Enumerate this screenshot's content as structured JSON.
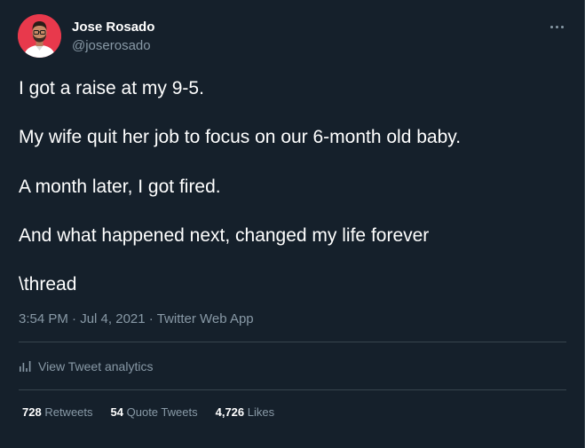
{
  "user": {
    "display_name": "Jose Rosado",
    "handle": "@joserosado"
  },
  "tweet": {
    "lines": [
      "I got a raise at my 9-5.",
      "My wife quit her job to focus on our 6-month old baby.",
      "A month later, I got fired.",
      "And what happened next, changed my life forever",
      "\\thread"
    ],
    "time": "3:54 PM",
    "separator": "·",
    "date": "Jul 4, 2021",
    "source": "Twitter Web App"
  },
  "analytics": {
    "label": "View Tweet analytics",
    "icon": "bar-chart-icon"
  },
  "stats": {
    "retweets_count": "728",
    "retweets_label": "Retweets",
    "quote_count": "54",
    "quote_label": "Quote Tweets",
    "likes_count": "4,726",
    "likes_label": "Likes"
  },
  "icons": {
    "more": "more-options-icon",
    "avatar": "avatar"
  },
  "colors": {
    "background": "#15202b",
    "primary_text": "#ffffff",
    "secondary_text": "#8899a6",
    "divider": "#38444d",
    "avatar_bg": "#e8394c"
  }
}
